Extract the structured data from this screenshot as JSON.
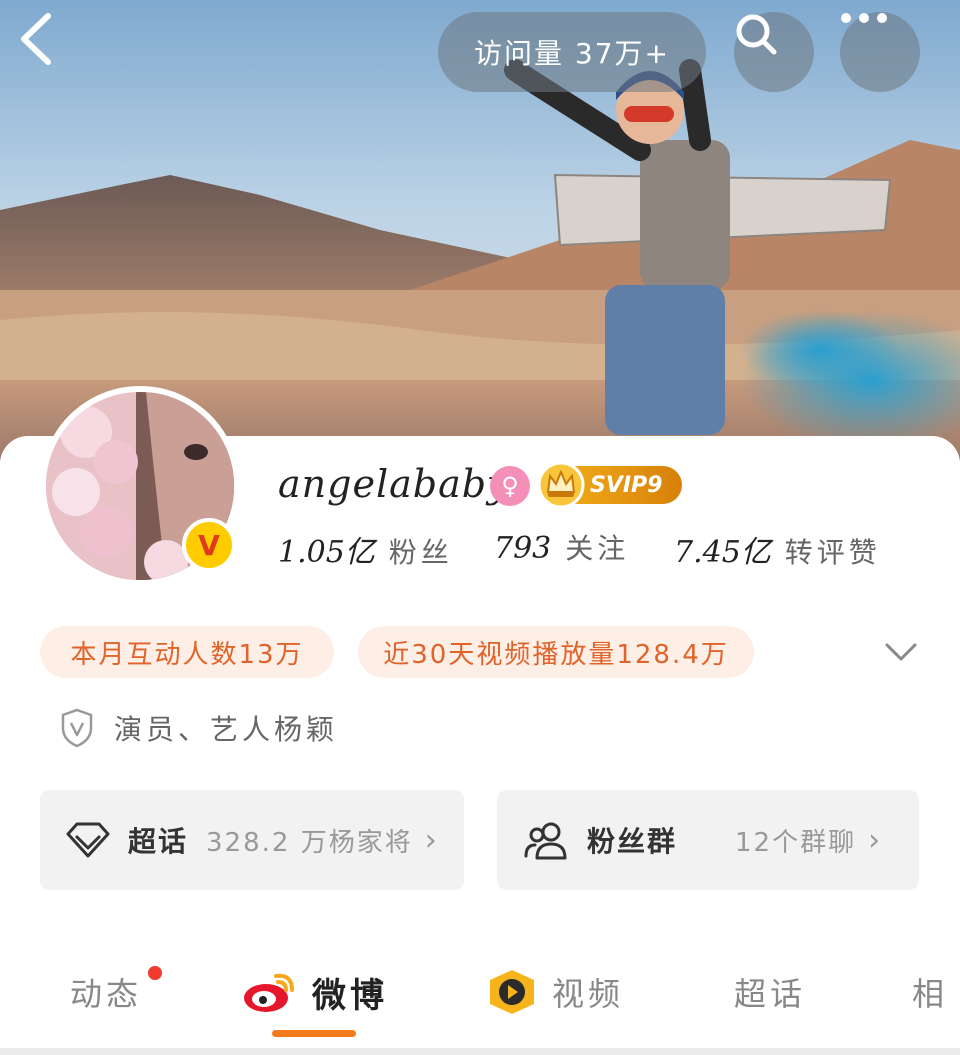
{
  "header": {
    "visit_count": "访问量 37万+"
  },
  "profile": {
    "username": "angelababy",
    "verified_badge_letter": "V",
    "svip_label": "SVIP9",
    "stats": [
      {
        "value": "1.05亿",
        "label": "粉丝"
      },
      {
        "value": "793",
        "label": "关注"
      },
      {
        "value": "7.45亿",
        "label": "转评赞"
      }
    ],
    "highlights": {
      "interact": "本月互动人数13万",
      "video": "近30天视频播放量128.4万"
    },
    "verification": "演员、艺人杨颖"
  },
  "boxes": {
    "supertopic": {
      "title": "超话",
      "sub": "328.2 万杨家将"
    },
    "fangroup": {
      "title": "粉丝群",
      "sub": "12个群聊"
    }
  },
  "tabs": {
    "dynamic": "动态",
    "weibo": "微博",
    "video": "视频",
    "super": "超话",
    "photo": "相"
  },
  "colors": {
    "accent_orange": "#f47a1e",
    "highlight_text": "#e0642a",
    "highlight_bg": "#fdeee6",
    "badge_red": "#f23a2e",
    "svip_gold": "#f6b31b",
    "gender_pink": "#f48fb8"
  }
}
